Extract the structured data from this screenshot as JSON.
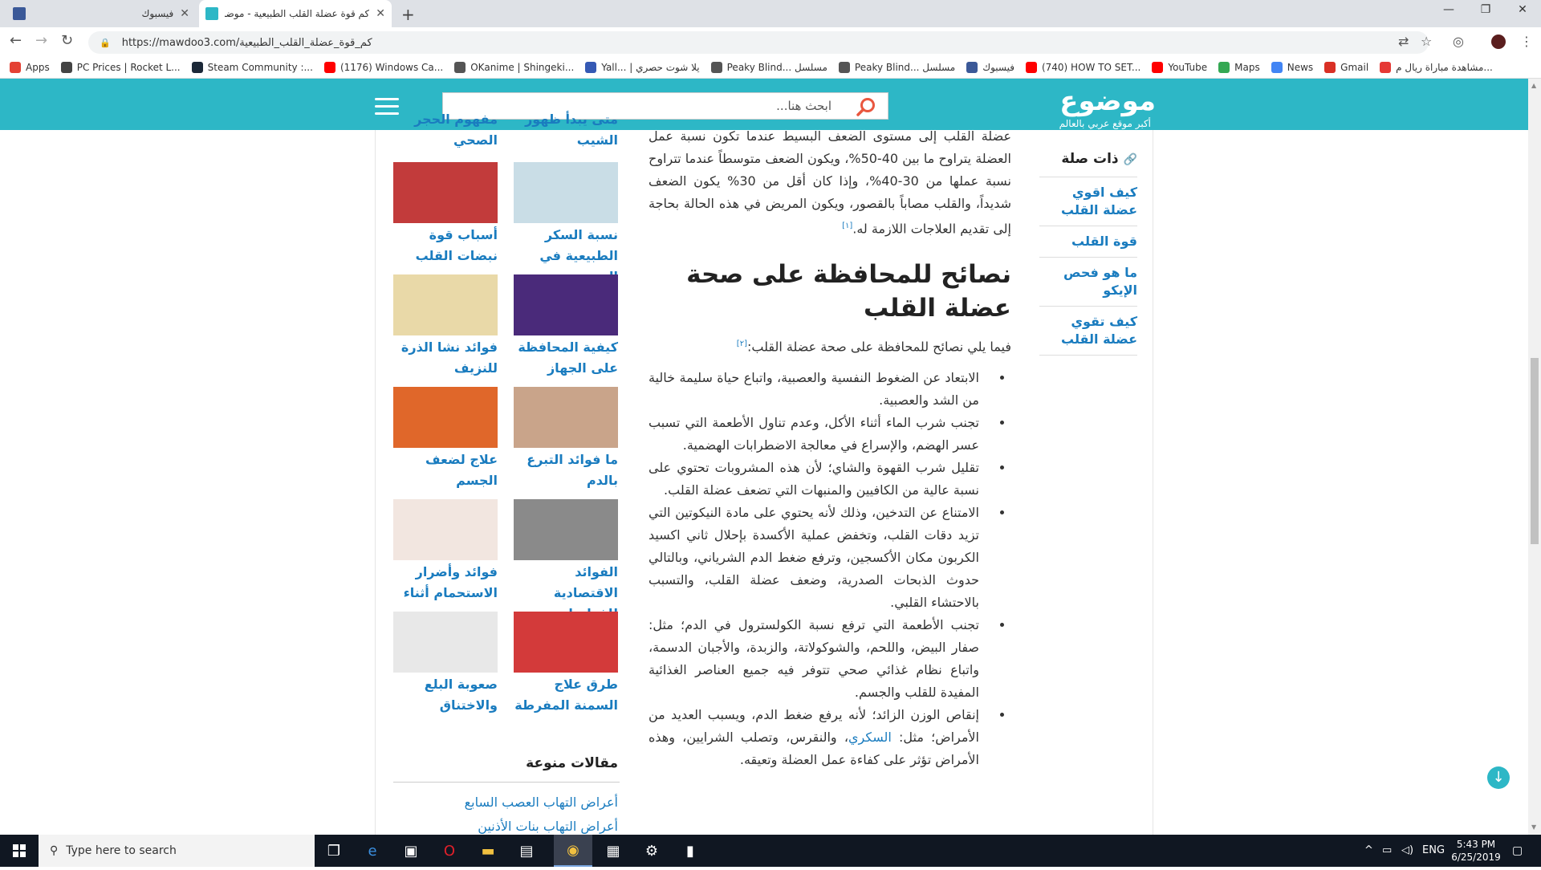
{
  "browser": {
    "tabs": [
      {
        "title": "فيسبوك",
        "active": false
      },
      {
        "title": "كم قوة عضلة القلب الطبيعية - موضوع",
        "active": true
      }
    ],
    "new_tab": "+",
    "url": "https://mawdoo3.com/كم_قوة_عضلة_القلب_الطبيعية",
    "bookmarks": [
      {
        "label": "Apps",
        "color": "#e44134"
      },
      {
        "label": "PC Prices | Rocket L...",
        "color": "#444444"
      },
      {
        "label": "Steam Community :...",
        "color": "#1b2838"
      },
      {
        "label": "(1176) Windows Ca...",
        "color": "#ff0000"
      },
      {
        "label": "OKanime | Shingeki...",
        "color": "#555555"
      },
      {
        "label": "Yall... | يلا شوت حصري",
        "color": "#3559b4"
      },
      {
        "label": "Peaky Blind... مسلسل",
        "color": "#555555"
      },
      {
        "label": "Peaky Blind... مسلسل",
        "color": "#555555"
      },
      {
        "label": "فيسبوك",
        "color": "#3b5998"
      },
      {
        "label": "(740) HOW TO SET...",
        "color": "#ff0000"
      },
      {
        "label": "YouTube",
        "color": "#ff0000"
      },
      {
        "label": "Maps",
        "color": "#34a853"
      },
      {
        "label": "News",
        "color": "#4285f4"
      },
      {
        "label": "Gmail",
        "color": "#d93025"
      },
      {
        "label": "مشاهدة مباراة ريال م...",
        "color": "#e53935"
      }
    ]
  },
  "site": {
    "logo": "موضوع",
    "tagline": "أكبر موقع عربي بالعالم",
    "search_placeholder": "ابحث هنا..."
  },
  "related": {
    "title": "ذات صلة",
    "items": [
      "كيف اقوي عضلة القلب",
      "قوة القلب",
      "ما هو فحص الإيكو",
      "كيف تقوي عضلة القلب"
    ]
  },
  "article": {
    "intro": "عضلة القلب إلى مستوى الضعف البسيط عندما تكون نسبة عمل العضلة يتراوح ما بين 40-50%، ويكون الضعف متوسطاً عندما تتراوح نسبة عملها من 30-40%، وإذا كان أقل من 30% يكون الضعف شديداً، والقلب مصاباً بالقصور، ويكون المريض في هذه الحالة بحاجة إلى تقديم العلاجات اللازمة له.",
    "intro_ref": "[١]",
    "heading": "نصائح للمحافظة على صحة عضلة القلب",
    "lead": "فيما يلي نصائح للمحافظة على صحة عضلة القلب:",
    "lead_ref": "[٢]",
    "bullets": [
      "الابتعاد عن الضغوط النفسية والعصبية، واتباع حياة سليمة خالية من الشد والعصبية.",
      "تجنب شرب الماء أثناء الأكل، وعدم تناول الأطعمة التي تسبب عسر الهضم، والإسراع في معالجة الاضطرابات الهضمية.",
      "تقليل شرب القهوة والشاي؛ لأن هذه المشروبات تحتوي على نسبة عالية من الكافيين والمنبهات التي تضعف عضلة القلب.",
      "الامتناع عن التدخين، وذلك لأنه يحتوي على مادة النيكوتين التي تزيد دقات القلب، وتخفض عملية الأكسدة بإحلال ثاني اكسيد الكربون مكان الأكسجين، وترفع ضغط الدم الشرياني، وبالتالي حدوث الذبحات الصدرية، وضعف عضلة القلب، والتسبب بالاحتشاء القلبي.",
      "تجنب الأطعمة التي ترفع نسبة الكولسترول في الدم؛ مثل: صفار البيض، واللحم، والشوكولاتة، والزبدة، والأجبان الدسمة، واتباع نظام غذائي صحي تتوفر فيه جميع العناصر الغذائية المفيدة للقلب والجسم."
    ],
    "last_bullet_a": "إنقاص الوزن الزائد؛ لأنه يرفع ضغط الدم، ويسبب العديد من الأمراض؛ مثل: ",
    "last_bullet_link": "السكري",
    "last_bullet_b": "، والنقرس، وتصلب الشرايين، وهذه الأمراض تؤثر على كفاءة عمل العضلة وتعيقه."
  },
  "sidebar_cards": {
    "top": [
      "متى يبدأ ظهور الشيب",
      "مفهوم الحجر الصحي"
    ],
    "rows": [
      [
        "نسبة السكر الطبيعية في الدم",
        "أسباب قوة نبضات القلب"
      ],
      [
        "كيفية المحافظة على الجهاز",
        "فوائد نشا الذرة للنزيف"
      ],
      [
        "ما فوائد التبرع بالدم",
        "علاج لضعف الجسم"
      ],
      [
        "الفوائد الاقتصادية للفطريات",
        "فوائد وأضرار الاستحمام أثناء"
      ],
      [
        "طرق علاج السمنة المفرطة",
        "صعوبة البلع والاختناق"
      ]
    ],
    "thumb_colors": [
      [
        "#c9dde6",
        "#c23b3b"
      ],
      [
        "#4a2a7a",
        "#e9d9a8"
      ],
      [
        "#c9a48a",
        "#e0672a"
      ],
      [
        "#8a8a8a",
        "#f2e6e0"
      ],
      [
        "#d33a3a",
        "#e8e8e8"
      ]
    ]
  },
  "misc": {
    "title": "مقالات منوعة",
    "links": [
      "أعراض التهاب العصب السابع",
      "أعراض التهاب بنات الأذنين"
    ]
  },
  "taskbar": {
    "search_placeholder": "Type here to search",
    "lang": "ENG",
    "time": "5:43 PM",
    "date": "6/25/2019"
  }
}
